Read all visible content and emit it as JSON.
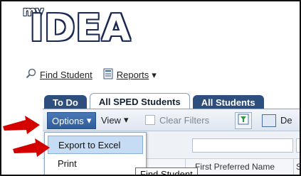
{
  "logo": {
    "prefix": "my",
    "name": "IDEA"
  },
  "top_toolbar": {
    "find_student": "Find Student",
    "find_student_underline": "F",
    "reports": "Reports"
  },
  "tabs": [
    {
      "label": "To Do",
      "active": false
    },
    {
      "label": "All SPED Students",
      "active": true
    },
    {
      "label": "All Students",
      "active": false
    }
  ],
  "grid_toolbar": {
    "options": "Options",
    "view": "View",
    "clear_filters": "Clear Filters",
    "de_partial": "De"
  },
  "options_menu": {
    "items": [
      "Export to Excel",
      "Print"
    ]
  },
  "grid": {
    "column_header_partial": "First Preferred Name",
    "column_header_next": "S"
  },
  "tooltip": "Find Student",
  "colors": {
    "tab_dark": "#2e4e7e",
    "menu_highlight": "#c6dcf4",
    "arrow": "#d40000"
  }
}
